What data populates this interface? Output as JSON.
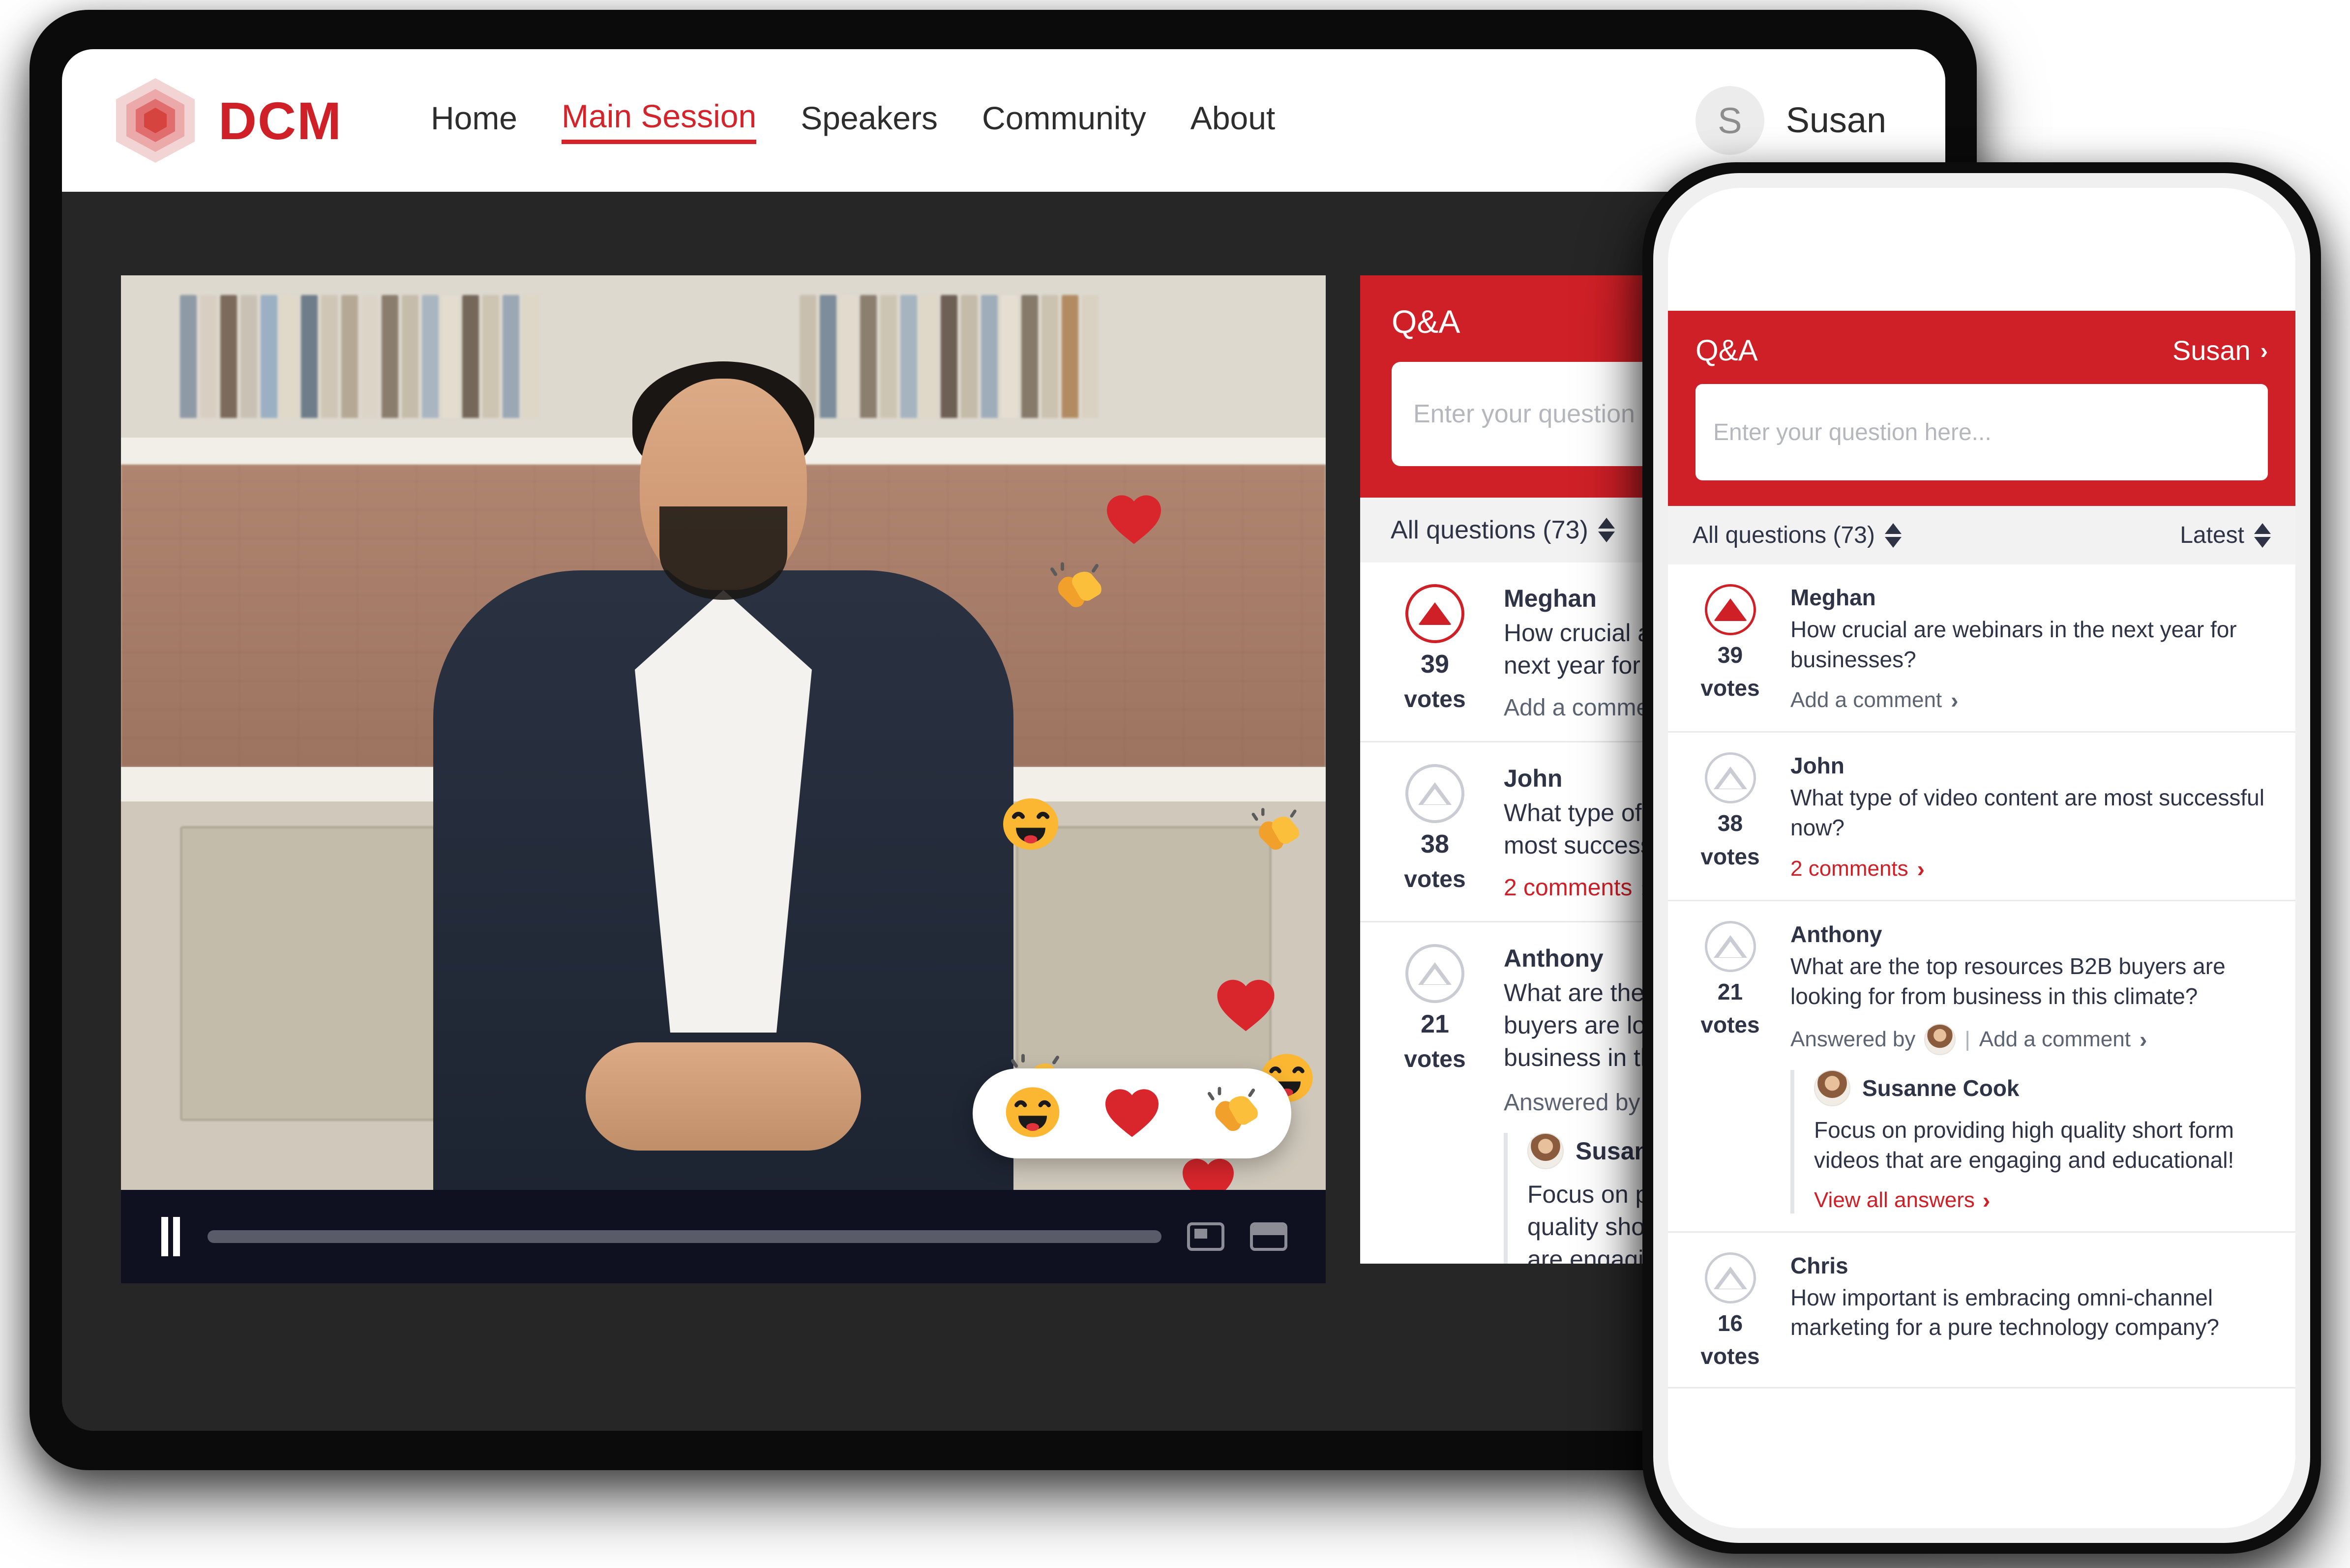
{
  "brand": {
    "name": "DCM",
    "logo_icon": "hexagon-layers-icon",
    "color": "#cf2027"
  },
  "nav": {
    "items": [
      {
        "label": "Home",
        "active": false
      },
      {
        "label": "Main Session",
        "active": true
      },
      {
        "label": "Speakers",
        "active": false
      },
      {
        "label": "Community",
        "active": false
      },
      {
        "label": "About",
        "active": false
      }
    ]
  },
  "user": {
    "initial": "S",
    "name": "Susan"
  },
  "video": {
    "play_state_icon": "pause-icon",
    "progress_percent": 0,
    "pip_icon": "picture-in-picture-icon",
    "theater_icon": "theater-mode-icon",
    "reactions": [
      {
        "icon": "grinning-face-icon",
        "glyph": "smile"
      },
      {
        "icon": "red-heart-icon",
        "glyph": "heart"
      },
      {
        "icon": "clapping-hands-icon",
        "glyph": "clap"
      }
    ]
  },
  "qa": {
    "title": "Q&A",
    "input_placeholder": "Enter your question here...",
    "input_value": "",
    "user_link": "Susan",
    "filter_label": "All questions (73)",
    "sort_label": "Latest",
    "questions": [
      {
        "author": "Meghan",
        "text": "How crucial are webinars in the next year for businesses?",
        "votes": "39",
        "votes_label": "votes",
        "voted": true,
        "meta": "Add a comment",
        "meta_red": false
      },
      {
        "author": "John",
        "text": "What type of video content are most successful now?",
        "votes": "38",
        "votes_label": "votes",
        "voted": false,
        "meta": "2 comments",
        "meta_red": true
      },
      {
        "author": "Anthony",
        "text": "What are the top resources B2B buyers are looking for from business in this climate?",
        "votes": "21",
        "votes_label": "votes",
        "voted": false,
        "answered_by_label": "Answered by",
        "meta": "Add a comment",
        "meta_red": false,
        "answer": {
          "name": "Susanne Cook",
          "text": "Focus on providing high quality short form videos that are engaging and educational!",
          "link": "View all answers"
        }
      },
      {
        "author": "Chris",
        "text": "How important is embracing omni-channel marketing for a pure technology company?",
        "votes": "16",
        "votes_label": "votes",
        "voted": false,
        "meta": "",
        "meta_red": false
      }
    ]
  }
}
